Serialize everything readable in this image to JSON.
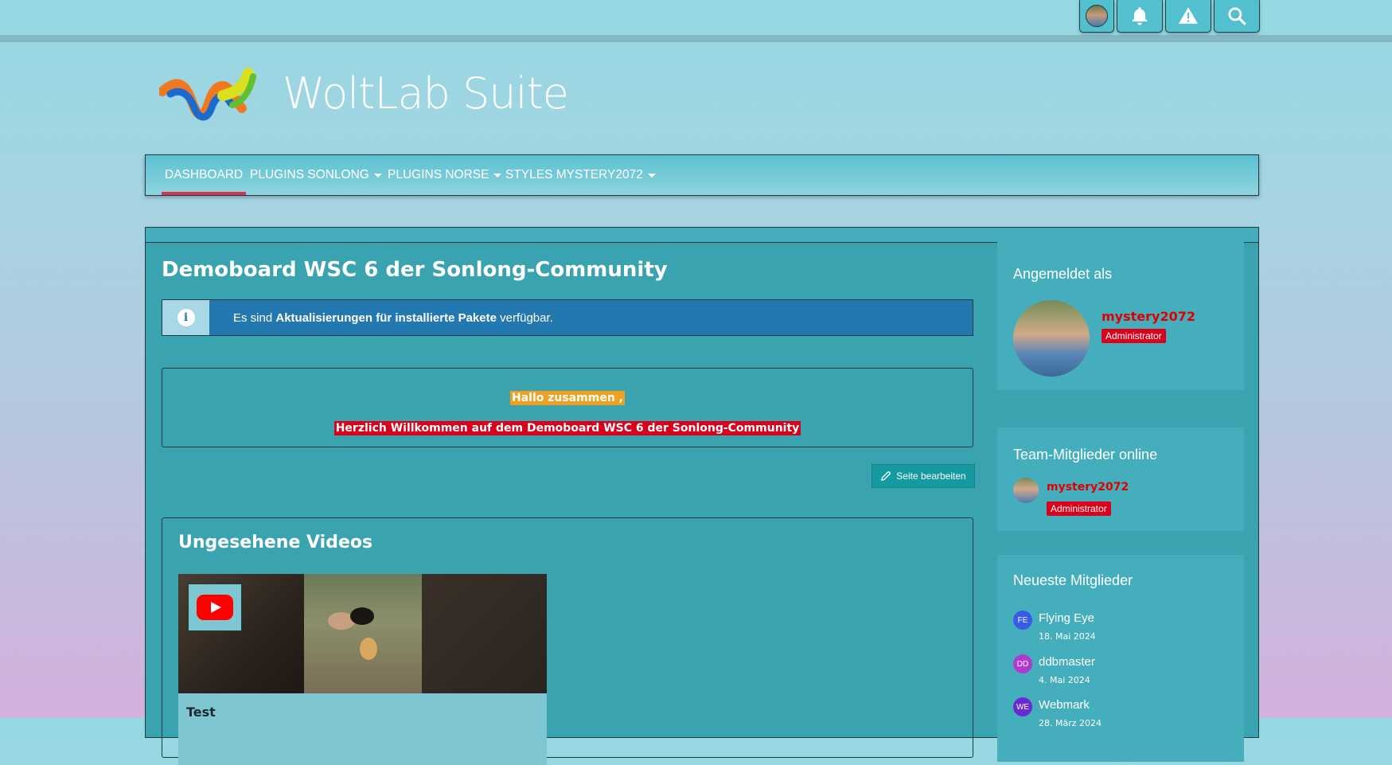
{
  "brand": {
    "name": "WoltLab Suite"
  },
  "topbar": {
    "icons": [
      "avatar",
      "bell-icon",
      "warning-icon",
      "search-icon"
    ]
  },
  "nav": {
    "items": [
      {
        "label": "DASHBOARD",
        "active": true,
        "dropdown": false
      },
      {
        "label": "PLUGINS SONLONG",
        "active": false,
        "dropdown": true
      },
      {
        "label": "PLUGINS NORSE",
        "active": false,
        "dropdown": true
      },
      {
        "label": "STYLES MYSTERY2072",
        "active": false,
        "dropdown": true
      }
    ]
  },
  "main": {
    "title": "Demoboard WSC 6 der Sonlong-Community",
    "info": {
      "prefix": "Es sind ",
      "strong": "Aktualisierungen für installierte Pakete",
      "suffix": " verfügbar."
    },
    "welcome": {
      "line1": "Hallo zusammen ,",
      "line2": "Herzlich Willkommen auf dem Demoboard WSC 6 der Sonlong-Community"
    },
    "edit_button": "Seite bearbeiten",
    "videos": {
      "title": "Ungesehene Videos",
      "items": [
        {
          "name": "Test"
        }
      ]
    }
  },
  "sidebar": {
    "logged_in": {
      "title": "Angemeldet als",
      "username": "mystery2072",
      "role": "Administrator"
    },
    "team_online": {
      "title": "Team-Mitglieder online",
      "username": "mystery2072",
      "role": "Administrator"
    },
    "newest_members": {
      "title": "Neueste Mitglieder",
      "members": [
        {
          "initials": "FE",
          "name": "Flying Eye",
          "date": "18. Mai 2024",
          "color": "#3a5ae8"
        },
        {
          "initials": "DD",
          "name": "ddbmaster",
          "date": "4. Mai 2024",
          "color": "#b03ad0"
        },
        {
          "initials": "WE",
          "name": "Webmark",
          "date": "28. März 2024",
          "color": "#6a2ad0"
        }
      ]
    }
  },
  "colors": {
    "accent_red": "#d8001a",
    "highlight_orange": "#f0a020",
    "info_blue": "#2478b0",
    "panel": "#3aa3b0"
  }
}
